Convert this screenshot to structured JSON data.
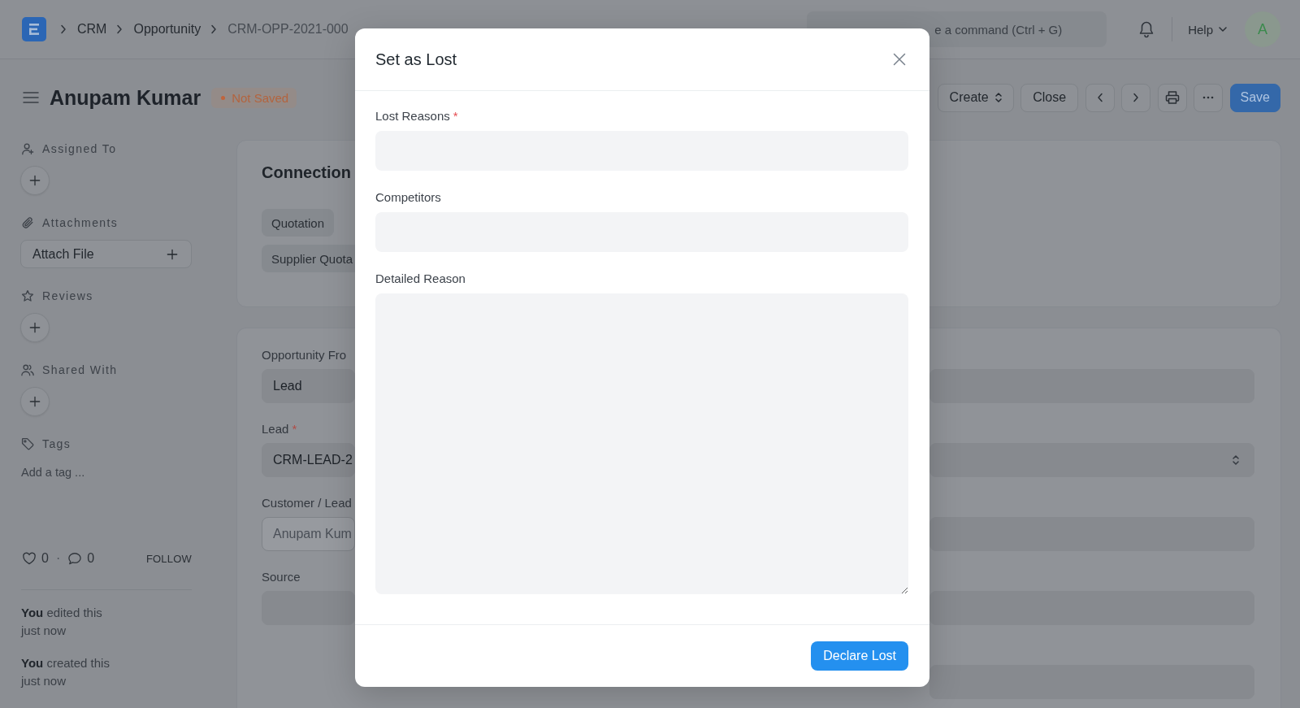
{
  "navbar": {
    "breadcrumbs": [
      "CRM",
      "Opportunity",
      "CRM-OPP-2021-000"
    ],
    "search": {
      "placeholder": "e a command (Ctrl + G)"
    },
    "help": "Help",
    "avatar": "A"
  },
  "page_header": {
    "title": "Anupam Kumar",
    "status": "Not Saved",
    "actions": [
      {
        "kind": "create",
        "label": "Create"
      },
      {
        "kind": "close",
        "label": "Close"
      },
      {
        "kind": "previous"
      },
      {
        "kind": "next"
      },
      {
        "kind": "print"
      },
      {
        "kind": "more"
      },
      {
        "kind": "save",
        "label": "Save"
      }
    ]
  },
  "sidebar": {
    "sections": [
      {
        "kind": "assign",
        "title": "Assigned To"
      },
      {
        "kind": "attach",
        "title": "Attachments",
        "button": "Attach File"
      },
      {
        "kind": "reviews",
        "title": "Reviews"
      },
      {
        "kind": "share",
        "title": "Shared With"
      },
      {
        "kind": "tags",
        "title": "Tags",
        "link": "Add a tag ..."
      }
    ],
    "likes": "0",
    "separator": "·",
    "comments": "0",
    "follow": "FOLLOW",
    "timeline": [
      "**You** edited this just now",
      "**You** created this just now"
    ]
  },
  "connections": {
    "title": "Connection",
    "links": [
      "Quotation",
      "Supplier Quota"
    ]
  },
  "form": {
    "left": [
      {
        "label": "Opportunity Fro",
        "value": "Lead",
        "read_only": false
      },
      {
        "label": "Lead",
        "required_mark": "*",
        "value": "CRM-LEAD-2",
        "read_only": false
      },
      {
        "label": "Customer / Lead",
        "value": "Anupam Kum",
        "read_only": true
      },
      {
        "label": "Source",
        "read_only": false
      }
    ],
    "right": [
      {
        "kind": "data"
      },
      {
        "kind": "select"
      },
      {
        "kind": "data"
      },
      {
        "kind": "data"
      },
      {
        "kind": "data"
      }
    ]
  },
  "modal": {
    "title": "Set as Lost",
    "fields": [
      {
        "kind": "multiselect",
        "label": "Lost Reasons",
        "required_mark": "*"
      },
      {
        "kind": "multiselect",
        "label": "Competitors"
      },
      {
        "kind": "textarea",
        "label": "Detailed Reason"
      }
    ],
    "primary_action": "Declare Lost"
  }
}
